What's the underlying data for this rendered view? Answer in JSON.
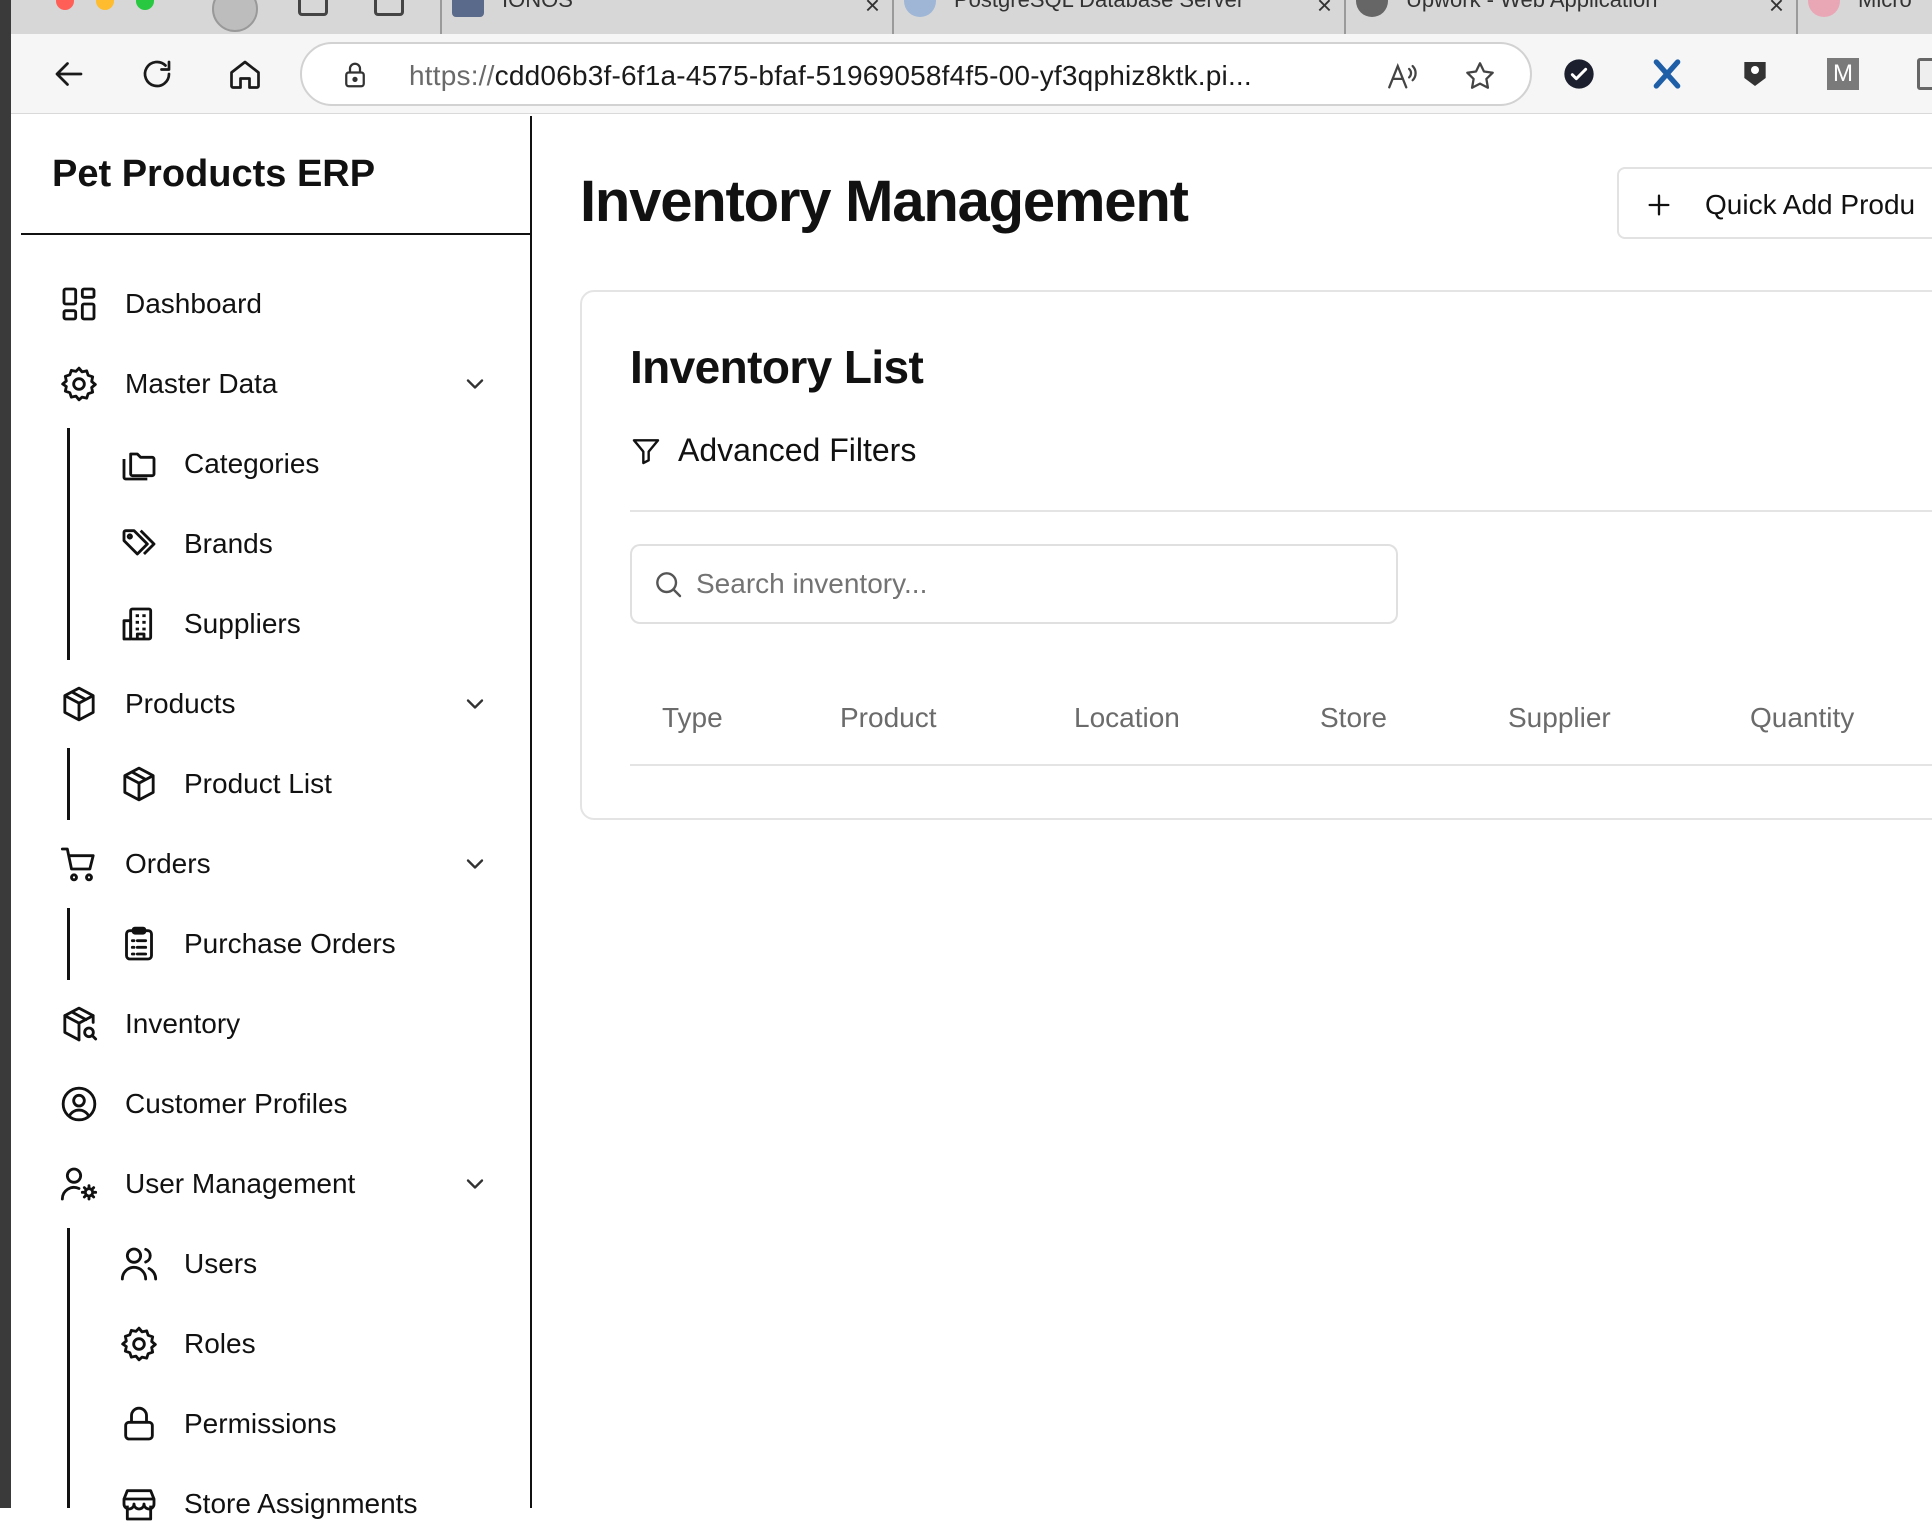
{
  "browser": {
    "tabs": [
      {
        "title": "IONOS",
        "icon": "ionos-favicon"
      },
      {
        "title": "PostgreSQL Database Server",
        "icon": "postgresql-favicon"
      },
      {
        "title": "Upwork - Web Application",
        "icon": "upwork-favicon"
      },
      {
        "title": "Micro",
        "icon": "microsoft-favicon"
      }
    ],
    "address": {
      "scheme": "https://",
      "rest": "cdd06b3f-6f1a-4575-bfaf-51969058f4f5-00-yf3qphiz8ktk.pi..."
    },
    "extensions": [
      "checkmark-extension-icon",
      "x-extension-icon",
      "keeper-extension-icon",
      "m-extension-icon",
      "notes-extension-icon"
    ],
    "extension_letter": "M"
  },
  "sidebar": {
    "brand": "Pet Products ERP",
    "items": [
      {
        "label": "Dashboard",
        "icon": "dashboard-icon"
      },
      {
        "label": "Master Data",
        "icon": "gear-icon",
        "expandable": true
      },
      {
        "label": "Categories",
        "icon": "folders-icon"
      },
      {
        "label": "Brands",
        "icon": "tags-icon"
      },
      {
        "label": "Suppliers",
        "icon": "building-icon"
      },
      {
        "label": "Products",
        "icon": "package-icon",
        "expandable": true
      },
      {
        "label": "Product List",
        "icon": "package-icon"
      },
      {
        "label": "Orders",
        "icon": "cart-icon",
        "expandable": true
      },
      {
        "label": "Purchase Orders",
        "icon": "clipboard-list-icon"
      },
      {
        "label": "Inventory",
        "icon": "package-search-icon"
      },
      {
        "label": "Customer Profiles",
        "icon": "user-circle-icon"
      },
      {
        "label": "User Management",
        "icon": "user-cog-icon",
        "expandable": true
      },
      {
        "label": "Users",
        "icon": "users-icon"
      },
      {
        "label": "Roles",
        "icon": "gear-icon"
      },
      {
        "label": "Permissions",
        "icon": "lock-icon"
      },
      {
        "label": "Store Assignments",
        "icon": "store-icon"
      }
    ]
  },
  "main": {
    "title": "Inventory Management",
    "quick_add_label": "Quick Add Produ",
    "card": {
      "title": "Inventory List",
      "filters_label": "Advanced Filters",
      "search_placeholder": "Search inventory...",
      "search_value": "",
      "columns": [
        "Type",
        "Product",
        "Location",
        "Store",
        "Supplier",
        "Quantity"
      ]
    }
  },
  "colors": {
    "text": "#111111",
    "muted": "#6b6b6b",
    "border": "#e4e4e4",
    "chrome": "#f6f6f6"
  }
}
